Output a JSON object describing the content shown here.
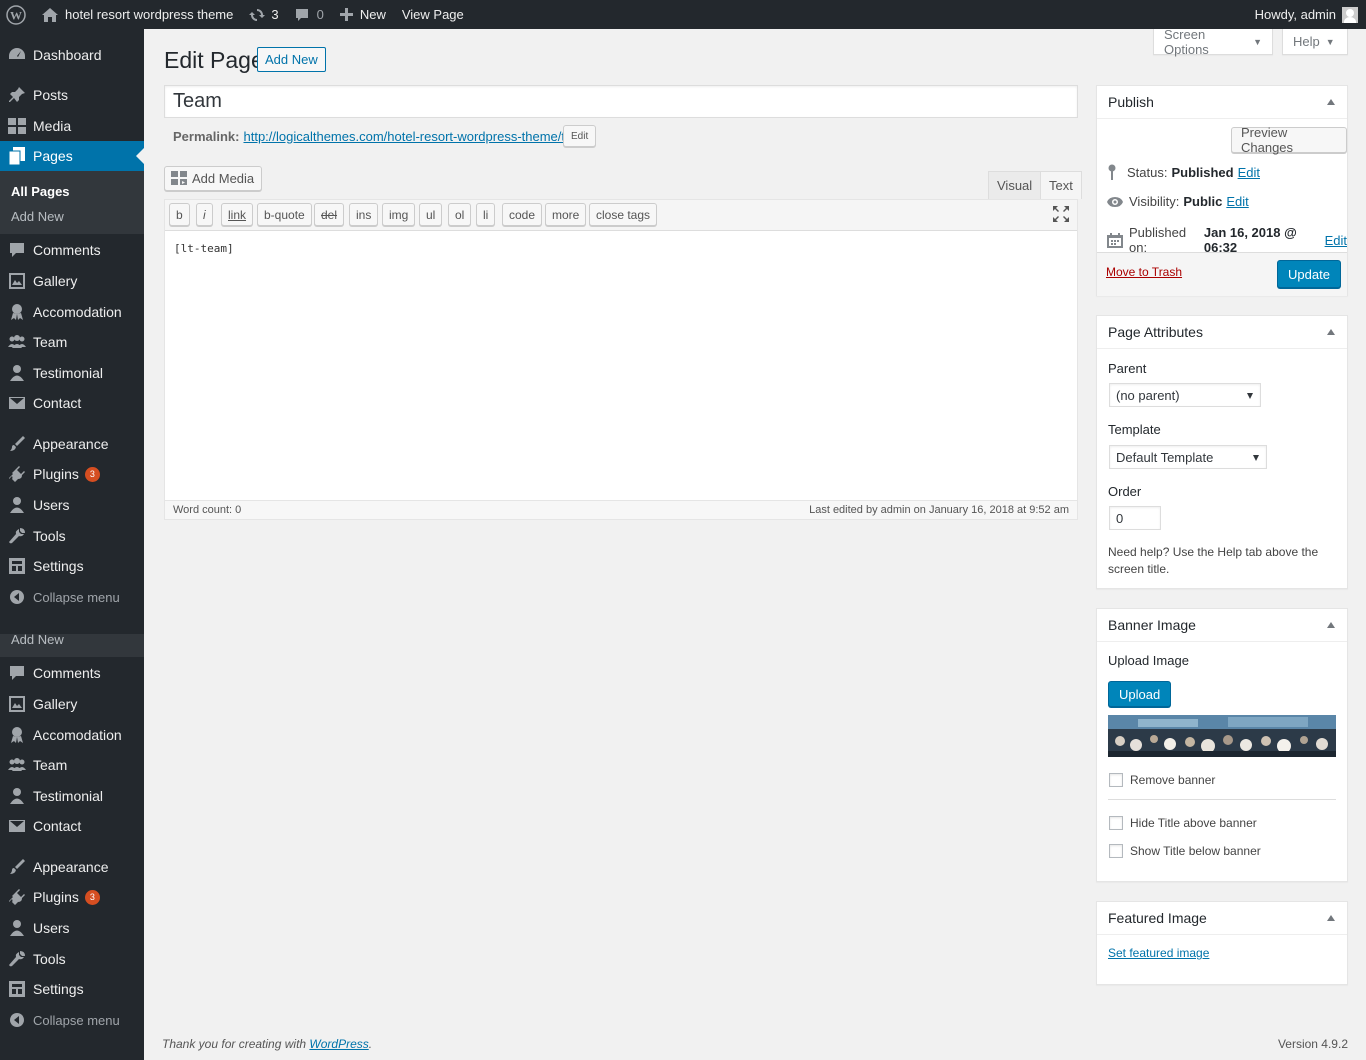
{
  "adminbar": {
    "site_name": "hotel resort wordpress theme",
    "updates_count": "3",
    "comments_count": "0",
    "new_label": "New",
    "view_page_label": "View Page",
    "howdy": "Howdy, admin"
  },
  "sidebar": {
    "dashboard": "Dashboard",
    "posts": "Posts",
    "media": "Media",
    "pages": "Pages",
    "all_pages": "All Pages",
    "add_new": "Add New",
    "comments": "Comments",
    "gallery": "Gallery",
    "accomodation": "Accomodation",
    "team": "Team",
    "testimonial": "Testimonial",
    "contact": "Contact",
    "appearance": "Appearance",
    "plugins": "Plugins",
    "plugins_badge": "3",
    "users": "Users",
    "tools": "Tools",
    "settings": "Settings",
    "collapse": "Collapse menu"
  },
  "header": {
    "screen_options": "Screen Options",
    "help": "Help",
    "title": "Edit Page",
    "add_new": "Add New"
  },
  "editor": {
    "post_title": "Team",
    "permalink_label": "Permalink:",
    "permalink_url": "http://logicalthemes.com/hotel-resort-wordpress-theme/team/",
    "permalink_edit": "Edit",
    "add_media": "Add Media",
    "tab_visual": "Visual",
    "tab_text": "Text",
    "quicktags": [
      "b",
      "i",
      "link",
      "b-quote",
      "del",
      "ins",
      "img",
      "ul",
      "ol",
      "li",
      "code",
      "more",
      "close tags"
    ],
    "content": "[lt-team]",
    "word_count": "Word count: 0",
    "last_edited": "Last edited by admin on January 16, 2018 at 9:52 am"
  },
  "publish": {
    "title": "Publish",
    "preview_changes": "Preview Changes",
    "status_label": "Status:",
    "status_value": "Published",
    "visibility_label": "Visibility:",
    "visibility_value": "Public",
    "published_label": "Published on:",
    "published_value": "Jan 16, 2018 @ 06:32",
    "edit": "Edit",
    "move_to_trash": "Move to Trash",
    "update": "Update"
  },
  "page_attributes": {
    "title": "Page Attributes",
    "parent_label": "Parent",
    "parent_value": "(no parent)",
    "template_label": "Template",
    "template_value": "Default Template",
    "order_label": "Order",
    "order_value": "0",
    "help_text": "Need help? Use the Help tab above the screen title."
  },
  "banner_image": {
    "title": "Banner Image",
    "upload_label": "Upload Image",
    "upload_button": "Upload",
    "remove_banner": "Remove banner",
    "hide_title": "Hide Title above banner",
    "show_title": "Show Title below banner"
  },
  "featured_image": {
    "title": "Featured Image",
    "set_link": "Set featured image"
  },
  "footer": {
    "thanks_prefix": "Thank you for creating with ",
    "wordpress": "WordPress",
    "thanks_suffix": ".",
    "version": "Version 4.9.2"
  },
  "colors": {
    "admin_bar": "#23282d",
    "sidebar": "#23282d",
    "accent": "#0073aa",
    "primary_button": "#0085ba",
    "badge": "#d54e21"
  }
}
